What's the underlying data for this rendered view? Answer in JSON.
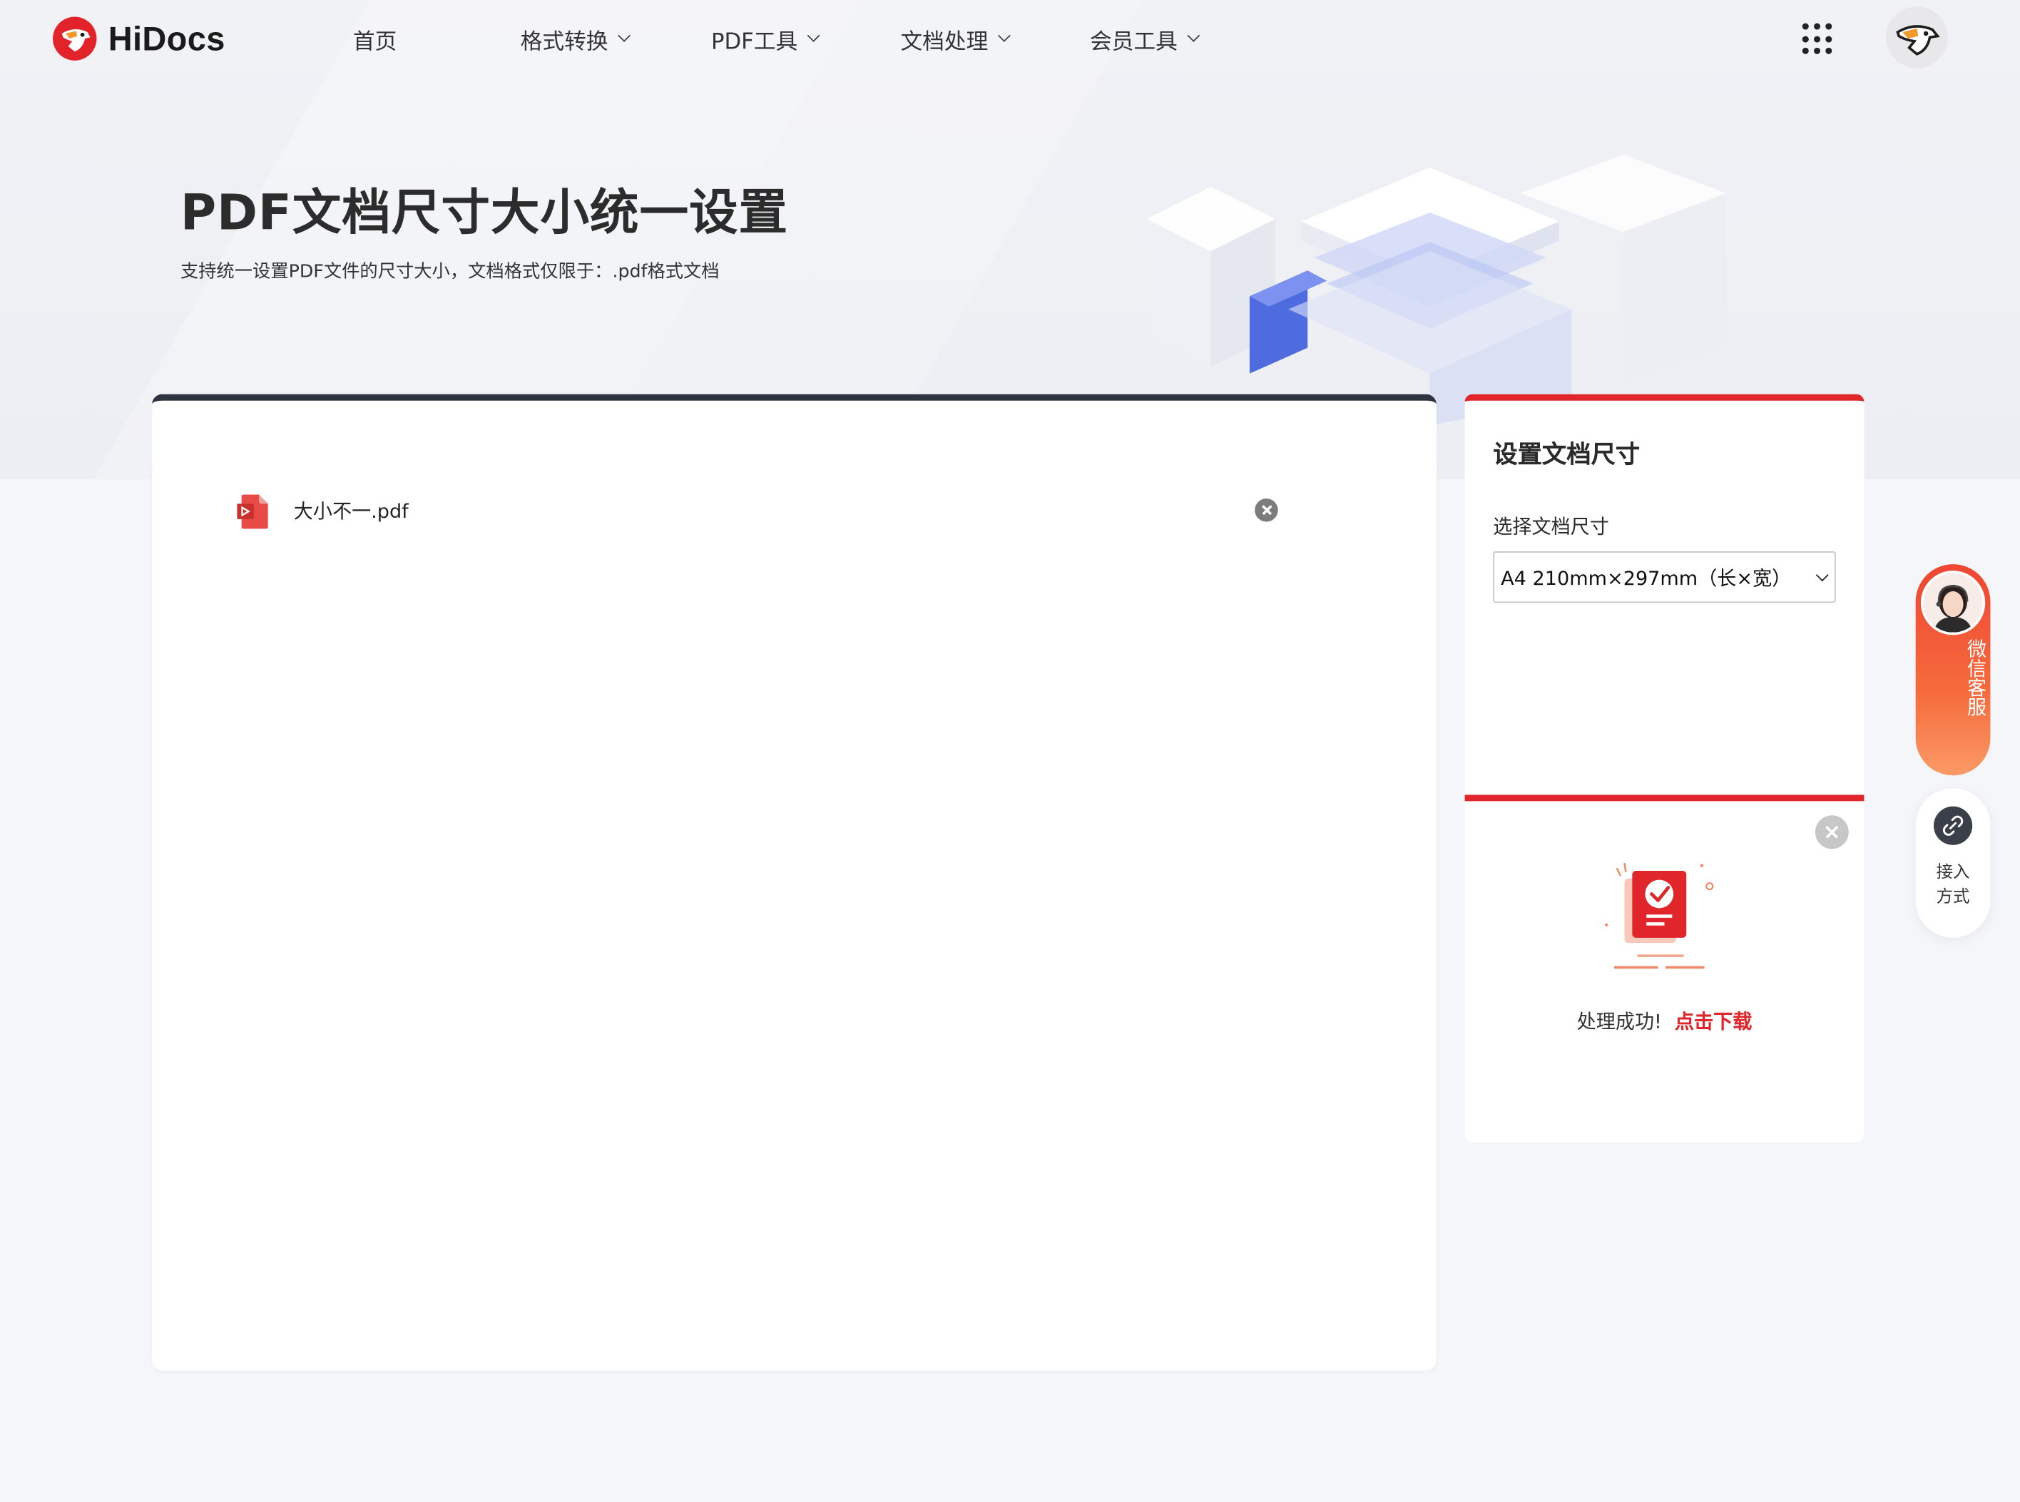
{
  "brand": {
    "name": "HiDocs"
  },
  "nav": {
    "items": [
      {
        "label": "首页",
        "has_menu": false
      },
      {
        "label": "格式转换",
        "has_menu": true
      },
      {
        "label": "PDF工具",
        "has_menu": true
      },
      {
        "label": "文档处理",
        "has_menu": true
      },
      {
        "label": "会员工具",
        "has_menu": true
      }
    ]
  },
  "hero": {
    "title": "PDF文档尺寸大小统一设置",
    "subtitle": "支持统一设置PDF文件的尺寸大小，文档格式仅限于：.pdf格式文档"
  },
  "files": [
    {
      "name": "大小不一.pdf",
      "icon": "pdf-file-icon"
    }
  ],
  "settings": {
    "title": "设置文档尺寸",
    "size_label": "选择文档尺寸",
    "size_value": "A4 210mm×297mm（长×宽）"
  },
  "result": {
    "message": "处理成功!",
    "download_label": "点击下载"
  },
  "float": {
    "service_label": "微信客服",
    "access_label_1": "接入",
    "access_label_2": "方式"
  },
  "colors": {
    "accent": "#e0262b",
    "panel_top_bar": "#2d3440",
    "background": "#f5f6f9"
  }
}
